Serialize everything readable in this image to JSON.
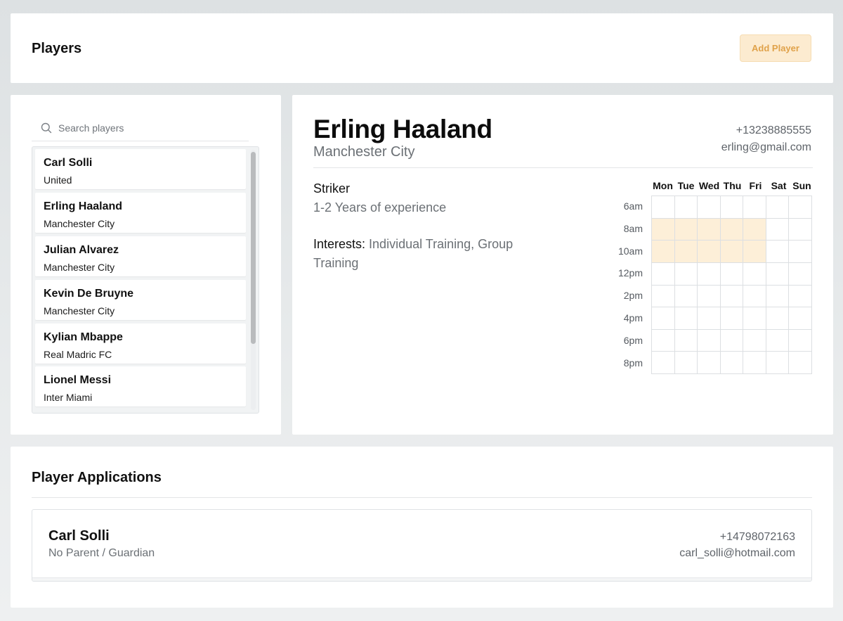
{
  "header": {
    "title": "Players",
    "add_button": "Add Player"
  },
  "search": {
    "placeholder": "Search players",
    "value": ""
  },
  "players": [
    {
      "name": "Carl Solli",
      "team": "United"
    },
    {
      "name": "Erling Haaland",
      "team": "Manchester City"
    },
    {
      "name": "Julian Alvarez",
      "team": "Manchester City"
    },
    {
      "name": "Kevin De Bruyne",
      "team": "Manchester City"
    },
    {
      "name": "Kylian Mbappe",
      "team": "Real Madric FC"
    },
    {
      "name": "Lionel Messi",
      "team": "Inter Miami"
    }
  ],
  "detail": {
    "name": "Erling Haaland",
    "team": "Manchester City",
    "phone": "+13238885555",
    "email": "erling@gmail.com",
    "position": "Striker",
    "experience": "1-2 Years of experience",
    "interests_label": "Interests:",
    "interests": "Individual Training, Group Training"
  },
  "schedule": {
    "days": [
      "Mon",
      "Tue",
      "Wed",
      "Thu",
      "Fri",
      "Sat",
      "Sun"
    ],
    "times": [
      "6am",
      "8am",
      "10am",
      "12pm",
      "2pm",
      "4pm",
      "6pm",
      "8pm"
    ],
    "available": [
      [
        0,
        0,
        0,
        0,
        0,
        0,
        0
      ],
      [
        1,
        1,
        1,
        1,
        1,
        0,
        0
      ],
      [
        1,
        1,
        1,
        1,
        1,
        0,
        0
      ],
      [
        0,
        0,
        0,
        0,
        0,
        0,
        0
      ],
      [
        0,
        0,
        0,
        0,
        0,
        0,
        0
      ],
      [
        0,
        0,
        0,
        0,
        0,
        0,
        0
      ],
      [
        0,
        0,
        0,
        0,
        0,
        0,
        0
      ],
      [
        0,
        0,
        0,
        0,
        0,
        0,
        0
      ]
    ],
    "available_color": "#fdefd8"
  },
  "applications": {
    "title": "Player Applications",
    "items": [
      {
        "name": "Carl Solli",
        "guardian": "No Parent / Guardian",
        "phone": "+14798072163",
        "email": "carl_solli@hotmail.com"
      }
    ]
  },
  "colors": {
    "accent": "#e0a24a",
    "accent_bg": "#fcebd0"
  }
}
